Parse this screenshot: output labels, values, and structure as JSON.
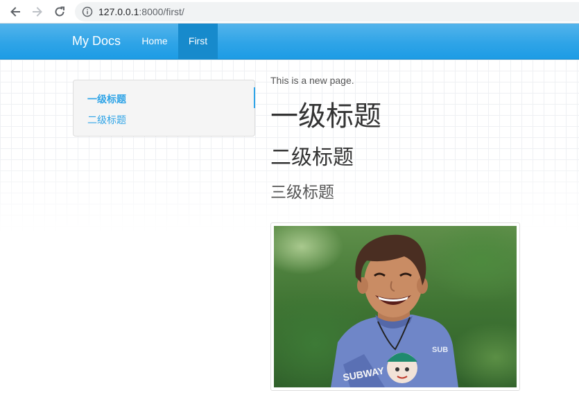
{
  "browser": {
    "url_host": "127.0.0.1",
    "url_path": ":8000/first/",
    "icons": {
      "back": "arrow-left-icon",
      "forward": "arrow-right-icon",
      "reload": "reload-icon",
      "info": "info-icon"
    }
  },
  "header": {
    "brand": "My Docs",
    "nav": [
      {
        "label": "Home",
        "active": false
      },
      {
        "label": "First",
        "active": true
      }
    ],
    "colors": {
      "bar": "#2fa4e7",
      "active_tab": "#178acc"
    }
  },
  "toc": {
    "items": [
      {
        "label": "一级标题",
        "level": 1,
        "active": true
      },
      {
        "label": "二级标题",
        "level": 2,
        "active": false
      }
    ]
  },
  "content": {
    "intro": "This is a new page.",
    "h1": "一级标题",
    "h2": "二级标题",
    "h3": "三级标题",
    "image": "photo of a smiling child"
  }
}
